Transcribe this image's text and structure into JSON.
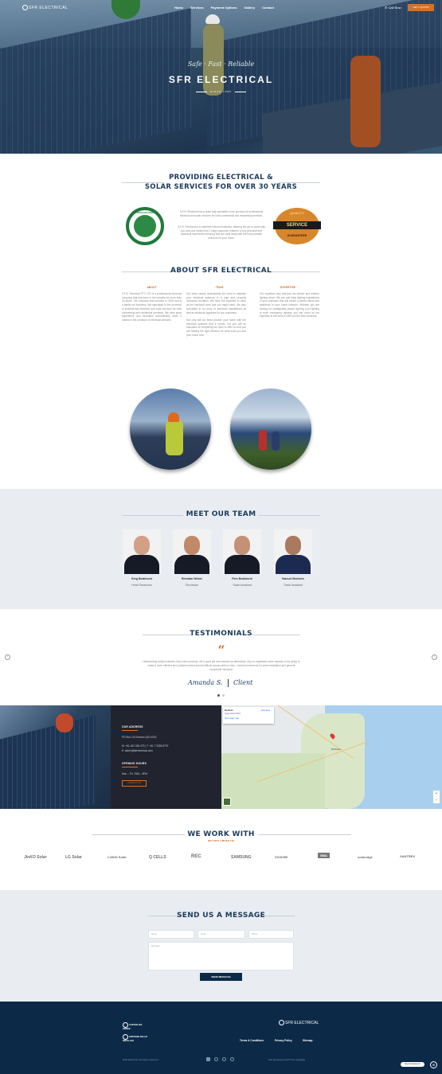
{
  "nav": {
    "logo": "SFR ELECTRICAL",
    "items": [
      "Home",
      "Services",
      "Payment Options",
      "Gallery",
      "Contact"
    ],
    "call": "Call Now",
    "quote": "GET A QUOTE"
  },
  "hero": {
    "tagline": "Safe · Fast · Reliable",
    "title": "SFR ELECTRICAL",
    "since": "SINCE 1990"
  },
  "providing": {
    "title_line1": "PROVIDING ELECTRICAL &",
    "title_line2": "SOLAR SERVICES FOR OVER 30 YEARS",
    "p1": "S.F.R. Electrical has a team that specialise in the provision of professional electrical and solar services for both commercial and residential premises.",
    "p2": "S.F.R. Electrical is a customer focused business, tailoring the job to what suits you and your family best. Craig's approach makes it a very personal and individual experience ensuring that you walk away with the best possible outcome for your home.",
    "badge_left": "AUSTRALIAN OWNED",
    "badge_right_top": "QUALITY",
    "badge_right_mid": "SERVICE",
    "badge_right_bot": "GUARANTEED"
  },
  "about": {
    "title": "ABOUT SFR ELECTRICAL",
    "cols": [
      {
        "head": "ABOUT",
        "text": "S.F.R. Electrical PTY LTD is a professional electrical company that has been in the industry for more than 30 years. The business was founded in 2006 and is a family run business. We specialise in the provision of professional electrical and solar services for both commercial and residential premises. We have great experience and incredible workmanship when it comes to the provision of electrical services."
      },
      {
        "head": "TEAM",
        "text": "Our team clearly understands the need to maintain your electrical systems in a safe and properly functional condition. We have the expertise to carry all the electrical work that you might need. We also specialise in an array of electrical installations as well as electrical upgrades for our customers.\n\nNot only will our team provide your home with the electrical systems that it needs, but you will be educated on everything we have to offer so that you are making the right decision for what suits you and your home best."
      },
      {
        "head": "EXPERTISE",
        "text": "Our expertise also extends into interior and exterior lighting decor. We can add ideal lighting installations in your premises that will create a perfect blend and ambience in your home interiors. Whether you are looking for strategically placed lighting, pool lighting or even emergency lighting, you can count on our expertise in the area to offer you the best solutions."
      }
    ]
  },
  "team": {
    "title": "MEET OUR TEAM",
    "members": [
      {
        "name": "Greg Beakhurst",
        "role": "Head Electrician"
      },
      {
        "name": "Brendan Weber",
        "role": "Electrician"
      },
      {
        "name": "Finn Beakhurst",
        "role": "Trade Assistant"
      },
      {
        "name": "Samuel Brothers",
        "role": "Trade Assistant"
      }
    ]
  },
  "testimonials": {
    "title": "TESTIMONIALS",
    "quote": "Hardworking family business, they were punctual, did a good job and cleaned up afterwards. Also re-organised some aspects of my setup to make it more efficient and problem solved around difficult access with no fuss. I would recommend for solar installation and general household electrical.",
    "author": "Amanda S.",
    "type": "Client"
  },
  "contact": {
    "our_address": "OUR ADDRESS",
    "address": "PO Box 124 Kedron QLD 4031",
    "phone": "M: +61 401 354 279 | T: +61 7 3355 8757",
    "email": "E: admin@sfrelectrical.com",
    "opening_hours": "OPENING HOURS",
    "hours": "Mon – Fri: 7AM – 5PM",
    "button": "CONTACT US",
    "map_place": "Kedron",
    "map_place_sub": "Queensland 4031",
    "map_link": "View larger map",
    "map_dir": "Directions",
    "map_city": "Brisbane"
  },
  "work": {
    "title": "WE WORK WITH",
    "sub": "(BUT NOT LIMITED TO)",
    "brands": [
      "JinKO Solar",
      "LG Solar",
      "LONGi Solar",
      "Q CELLS",
      "REC",
      "SAMSUNG",
      "GOODWE",
      "SMA",
      "solaredge",
      "XANTREX"
    ]
  },
  "form": {
    "title": "SEND US A MESSAGE",
    "name_ph": "Name",
    "email_ph": "Email",
    "phone_ph": "Phone",
    "msg_ph": "Message",
    "button": "SEND MESSAGE"
  },
  "footer": {
    "logo": "SFR ELECTRICAL",
    "badge1": "AUSTRALIAN OWNED",
    "badge2": "CERTIFIED SOLAR INSTALLER",
    "links": [
      "Terms & Conditions",
      "Privacy Policy",
      "Sitemap"
    ],
    "copyright": "SFR Electrical. All rights reserved.",
    "credit": "Site Developed with ♥ by wyDigital",
    "chat": "Need Assistance?"
  },
  "colors": {
    "navy": "#1b3a5c",
    "orange": "#d2712a",
    "footer": "#0c2a48"
  }
}
